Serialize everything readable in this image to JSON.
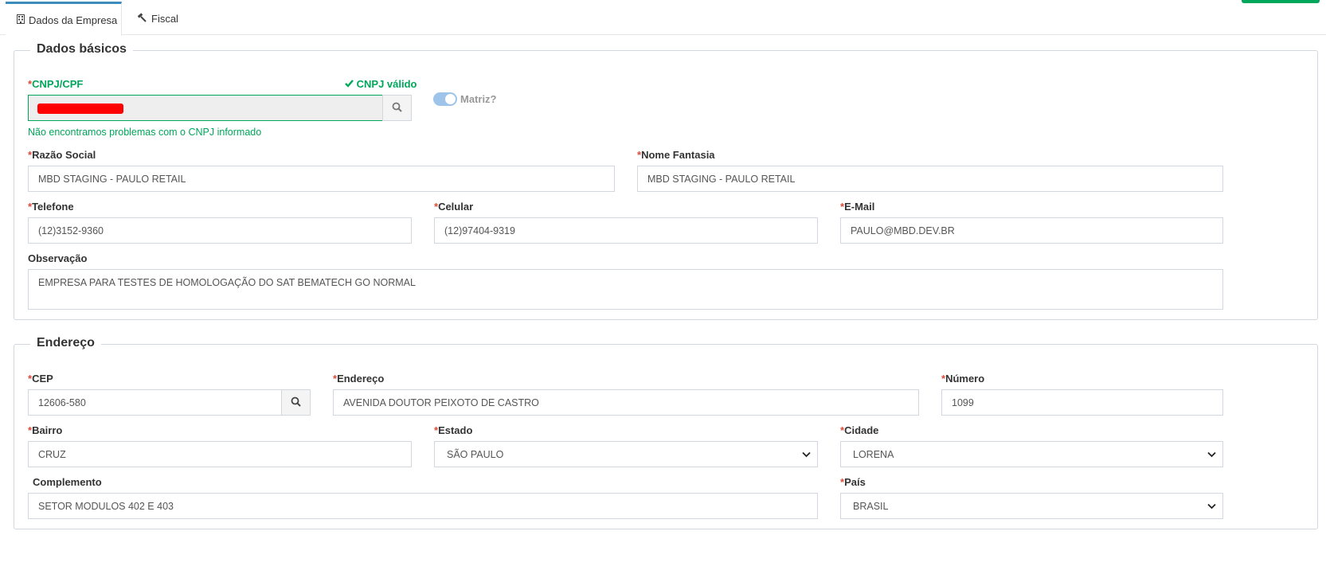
{
  "tabs": [
    {
      "label": "Dados da Empresa",
      "icon": "building-icon"
    },
    {
      "label": "Fiscal",
      "icon": "gavel-icon"
    }
  ],
  "dados_basicos": {
    "legend": "Dados básicos",
    "cnpj": {
      "label": "CNPJ/CPF",
      "status": "CNPJ válido",
      "help": "Não encontramos problemas com o CNPJ informado"
    },
    "matriz": {
      "label": "Matriz?",
      "checked": true
    },
    "razao_social": {
      "label": "Razão Social",
      "value": "MBD STAGING - PAULO RETAIL"
    },
    "nome_fantasia": {
      "label": "Nome Fantasia",
      "value": "MBD STAGING - PAULO RETAIL"
    },
    "telefone": {
      "label": "Telefone",
      "value": "(12)3152-9360"
    },
    "celular": {
      "label": "Celular",
      "value": "(12)97404-9319"
    },
    "email": {
      "label": "E-Mail",
      "value": "PAULO@MBD.DEV.BR"
    },
    "observacao": {
      "label": "Observação",
      "value": "EMPRESA PARA TESTES DE HOMOLOGAÇÃO DO SAT BEMATECH GO NORMAL"
    }
  },
  "endereco": {
    "legend": "Endereço",
    "cep": {
      "label": "CEP",
      "value": "12606-580"
    },
    "endereco": {
      "label": "Endereço",
      "value": "AVENIDA DOUTOR PEIXOTO DE CASTRO"
    },
    "numero": {
      "label": "Número",
      "value": "1099"
    },
    "bairro": {
      "label": "Bairro",
      "value": "CRUZ"
    },
    "estado": {
      "label": "Estado",
      "value": "SÃO PAULO"
    },
    "cidade": {
      "label": "Cidade",
      "value": "LORENA"
    },
    "complemento": {
      "label": "Complemento",
      "value": "SETOR MODULOS 402 E 403"
    },
    "pais": {
      "label": "País",
      "value": "BRASIL"
    }
  },
  "required_mark": "*",
  "colors": {
    "accent": "#3c8dbc",
    "success": "#00a65a",
    "required": "#dd4b39",
    "redaction": "#ff0000"
  }
}
